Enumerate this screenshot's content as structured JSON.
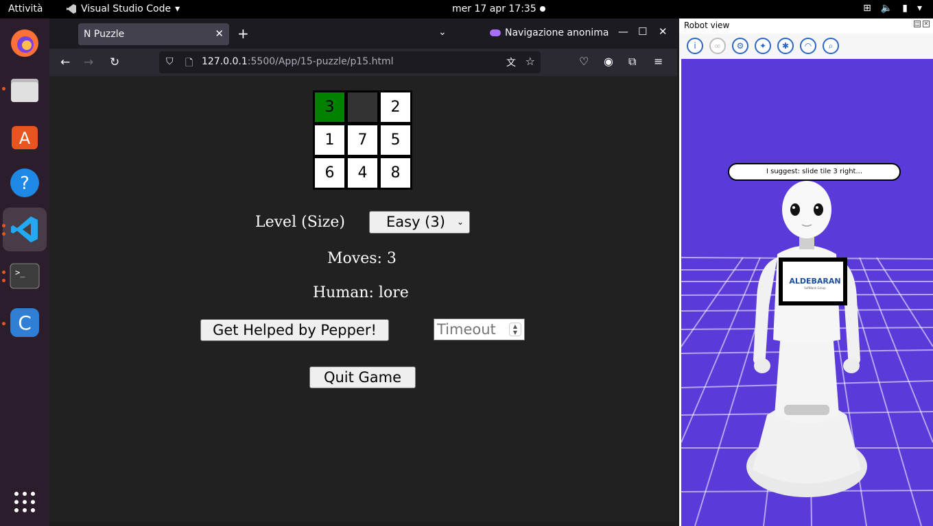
{
  "topbar": {
    "activities": "Attività",
    "app_name": "Visual Studio Code",
    "clock": "mer 17 apr  17:35"
  },
  "dock": {
    "items": [
      "firefox-icon",
      "files-icon",
      "software-icon",
      "help-icon",
      "vscode-icon",
      "terminal-icon",
      "cursor-app-icon"
    ],
    "show_apps": "show-applications-icon"
  },
  "browser": {
    "tab_title": "N Puzzle",
    "private_label": "Navigazione anonima",
    "url_host": "127.0.0.1",
    "url_path": ":5500/App/15-puzzle/p15.html"
  },
  "puzzle": {
    "tiles": [
      "3",
      "",
      "2",
      "1",
      "7",
      "5",
      "6",
      "4",
      "8"
    ],
    "level_label": "Level (Size)",
    "level_value": "Easy (3)",
    "moves": "Moves: 3",
    "human": "Human: lore",
    "help_button": "Get Helped by Pepper!",
    "timeout_placeholder": "Timeout",
    "quit_button": "Quit Game"
  },
  "robot": {
    "title": "Robot view",
    "speech": "I suggest: slide tile 3 right...",
    "tablet_logo": "ALDEBARAN",
    "tablet_sub": "SoftBank Group"
  },
  "colors": {
    "scene_bg": "#5a3bd9",
    "highlight_tile": "#008000"
  }
}
